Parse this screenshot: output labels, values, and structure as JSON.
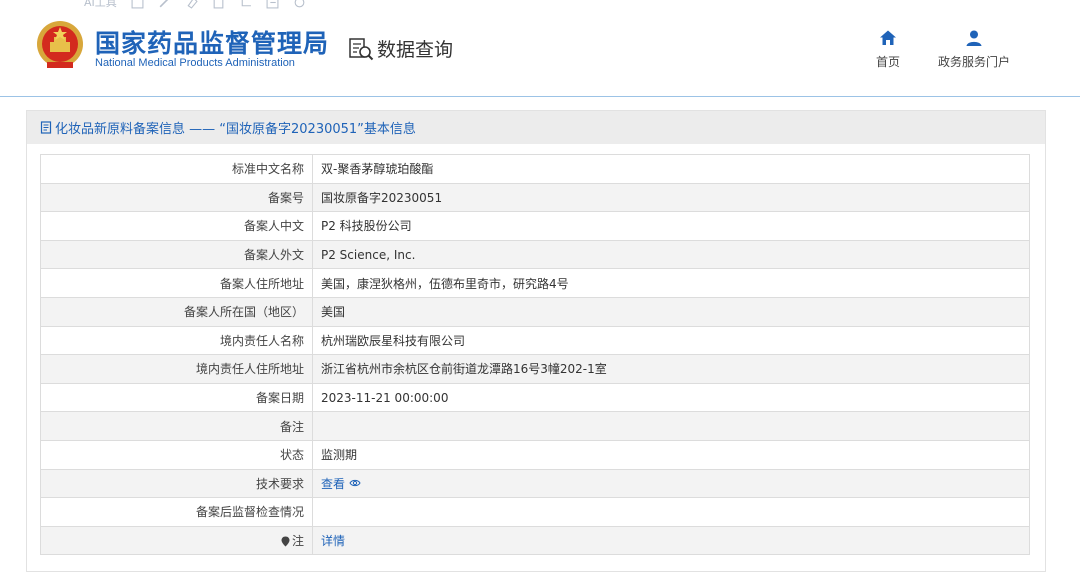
{
  "toolbar": {
    "ai_label": "AI工具"
  },
  "header": {
    "org_cn": "国家药品监督管理局",
    "org_en": "National Medical Products Administration",
    "query_label": "数据查询",
    "nav": [
      {
        "label": "首页",
        "icon": "home-icon"
      },
      {
        "label": "政务服务门户",
        "icon": "user-icon"
      }
    ]
  },
  "panel": {
    "title": "化妆品新原料备案信息 —— “国妆原备字20230051”基本信息",
    "rows": [
      {
        "key": "标准中文名称",
        "value": "双-聚香茅醇琥珀酸酯"
      },
      {
        "key": "备案号",
        "value": "国妆原备字20230051"
      },
      {
        "key": "备案人中文",
        "value": "P2 科技股份公司"
      },
      {
        "key": "备案人外文",
        "value": "P2 Science, Inc."
      },
      {
        "key": "备案人住所地址",
        "value": "美国，康涅狄格州，伍德布里奇市，研究路4号"
      },
      {
        "key": "备案人所在国（地区）",
        "value": "美国"
      },
      {
        "key": "境内责任人名称",
        "value": "杭州瑞欧辰星科技有限公司"
      },
      {
        "key": "境内责任人住所地址",
        "value": "浙江省杭州市余杭区仓前街道龙潭路16号3幢202-1室"
      },
      {
        "key": "备案日期",
        "value": "2023-11-21 00:00:00"
      },
      {
        "key": "备注",
        "value": ""
      },
      {
        "key": "状态",
        "value": "监测期"
      },
      {
        "key": "技术要求",
        "value": "查看"
      },
      {
        "key": "备案后监督检查情况",
        "value": ""
      },
      {
        "key": "注",
        "value": "详情"
      }
    ]
  },
  "colors": {
    "brand_blue": "#1f63b8",
    "header_rule": "#9cc3e6",
    "row_alt": "#f3f3f3"
  }
}
